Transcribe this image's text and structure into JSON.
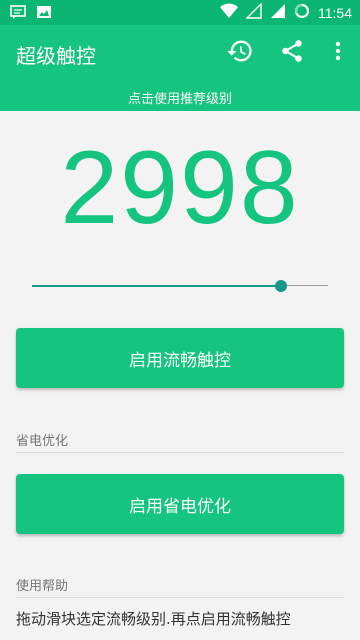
{
  "status_bar": {
    "time": "11:54"
  },
  "app_bar": {
    "title": "超级触控",
    "subtitle": "点击使用推荐级别"
  },
  "main": {
    "level_value": "2998",
    "slider_fraction": 0.84
  },
  "buttons": {
    "enable_smooth": "启用流畅触控",
    "enable_power_save": "启用省电优化"
  },
  "sections": {
    "power_save_label": "省电优化",
    "help_label": "使用帮助",
    "help_text": "拖动滑块选定流畅级别.再点启用流畅触控"
  },
  "colors": {
    "accent": "#14c47f",
    "status_bar": "#0bb572",
    "slider": "#159a88"
  }
}
